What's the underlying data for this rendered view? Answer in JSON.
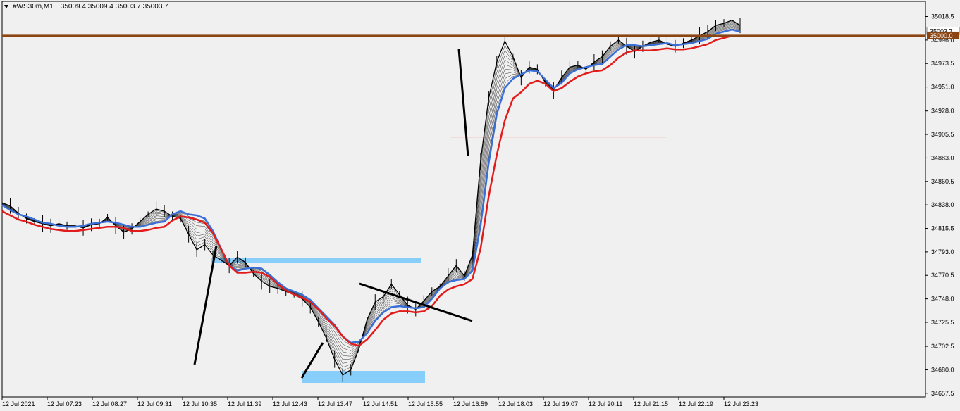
{
  "header": {
    "symbol": "#WS30m,M1",
    "ohlc": "35009.4 35009.4 35003.7 35003.7"
  },
  "price_tag": {
    "current": "35003.7",
    "level": "35000.0"
  },
  "colors": {
    "background": "#f0f0f0",
    "candles": "#000000",
    "fast_ma": "#3a6fd8",
    "slow_ma": "#e31b1b",
    "ribbon": "#000000",
    "level_line": "#8b4513",
    "zone": "#87cefa"
  },
  "chart_data": {
    "type": "line",
    "title": "",
    "y_ticks": [
      35018.5,
      34996.0,
      34973.5,
      34951.0,
      34928.0,
      34905.5,
      34883.0,
      34860.5,
      34838.0,
      34815.5,
      34793.0,
      34770.5,
      34748.0,
      34725.5,
      34702.5,
      34680.0,
      34657.5
    ],
    "y_tick_labels": [
      "35018.5",
      "34996.0",
      "34973.5",
      "34951.0",
      "34928.0",
      "34905.5",
      "34883.0",
      "34860.5",
      "34838.0",
      "34815.5",
      "34793.0",
      "34770.5",
      "34748.0",
      "34725.5",
      "34702.5",
      "34680.0",
      "34657.5"
    ],
    "ylim": [
      34654,
      35033
    ],
    "x_labels": [
      "12 Jul 2021",
      "12 Jul 07:23",
      "12 Jul 08:27",
      "12 Jul 09:31",
      "12 Jul 10:35",
      "12 Jul 11:39",
      "12 Jul 12:43",
      "12 Jul 13:47",
      "12 Jul 14:51",
      "12 Jul 15:55",
      "12 Jul 16:59",
      "12 Jul 18:03",
      "12 Jul 19:07",
      "12 Jul 20:11",
      "12 Jul 21:15",
      "12 Jul 22:19",
      "12 Jul 23:23"
    ],
    "series": [
      {
        "values": [
          34838,
          34833,
          34829,
          34827,
          34824,
          34821,
          34820,
          34818,
          34817,
          34817,
          34818,
          34820,
          34821,
          34822,
          34821,
          34819,
          34817,
          34817,
          34819,
          34821,
          34822,
          34829,
          34832,
          34829,
          34828,
          34825,
          34813,
          34796,
          34780,
          34775,
          34777,
          34778,
          34777,
          34771,
          34764,
          34758,
          34755,
          34752,
          34747,
          34739,
          34731,
          34723,
          34712,
          34706,
          34707,
          34715,
          34727,
          34735,
          34740,
          34741,
          34740,
          34739,
          34740,
          34748,
          34758,
          34764,
          34766,
          34767,
          34775,
          34818,
          34878,
          34925,
          34950,
          34959,
          34963,
          34967,
          34966,
          34958,
          34950,
          34955,
          34964,
          34968,
          34970,
          34972,
          34973,
          34980,
          34987,
          34991,
          34991,
          34990,
          34991,
          34992,
          34993,
          34991,
          34992,
          34993,
          34995,
          34997,
          35002,
          35004,
          35006,
          35004
        ]
      },
      {
        "values": [
          34836,
          34832,
          34828,
          34826,
          34823,
          34821,
          34819,
          34818,
          34817,
          34817,
          34818,
          34819,
          34820,
          34821,
          34821,
          34820,
          34817,
          34817,
          34818,
          34820,
          34821,
          34827,
          34831,
          34830,
          34828,
          34825,
          34815,
          34800,
          34784,
          34777,
          34777,
          34778,
          34777,
          34773,
          34766,
          34760,
          34756,
          34753,
          34749,
          34742,
          34733,
          34726,
          34716,
          34709,
          34707,
          34713,
          34722,
          34732,
          34738,
          34740,
          34740,
          34739,
          34740,
          34745,
          34755,
          34761,
          34764,
          34766,
          34771,
          34800,
          34850,
          34890,
          34923,
          34944,
          34950,
          34958,
          34961,
          34958,
          34951,
          34954,
          34960,
          34965,
          34968,
          34970,
          34971,
          34976,
          34983,
          34988,
          34990,
          34990,
          34990,
          34991,
          34992,
          34991,
          34991,
          34992,
          34994,
          34996,
          35000,
          35002,
          35004,
          35004
        ]
      },
      {
        "values": [
          34840,
          34837,
          34830,
          34825,
          34822,
          34820,
          34818,
          34820,
          34818,
          34818,
          34816,
          34819,
          34820,
          34826,
          34818,
          34812,
          34815,
          34822,
          34829,
          34834,
          34832,
          34827,
          34825,
          34810,
          34795,
          34800,
          34790,
          34785,
          34780,
          34788,
          34783,
          34772,
          34765,
          34760,
          34758,
          34755,
          34752,
          34748,
          34740,
          34726,
          34710,
          34690,
          34675,
          34680,
          34700,
          34728,
          34745,
          34750,
          34762,
          34752,
          34742,
          34738,
          34746,
          34755,
          34760,
          34770,
          34780,
          34770,
          34790,
          34880,
          34940,
          34975,
          34995,
          34980,
          34960,
          34970,
          34968,
          34955,
          34948,
          34960,
          34970,
          34972,
          34968,
          34975,
          34980,
          34990,
          34996,
          34990,
          34985,
          34990,
          34994,
          34996,
          34992,
          34990,
          34993,
          34996,
          35000,
          35004,
          35010,
          35012,
          35015,
          35010
        ]
      }
    ]
  }
}
